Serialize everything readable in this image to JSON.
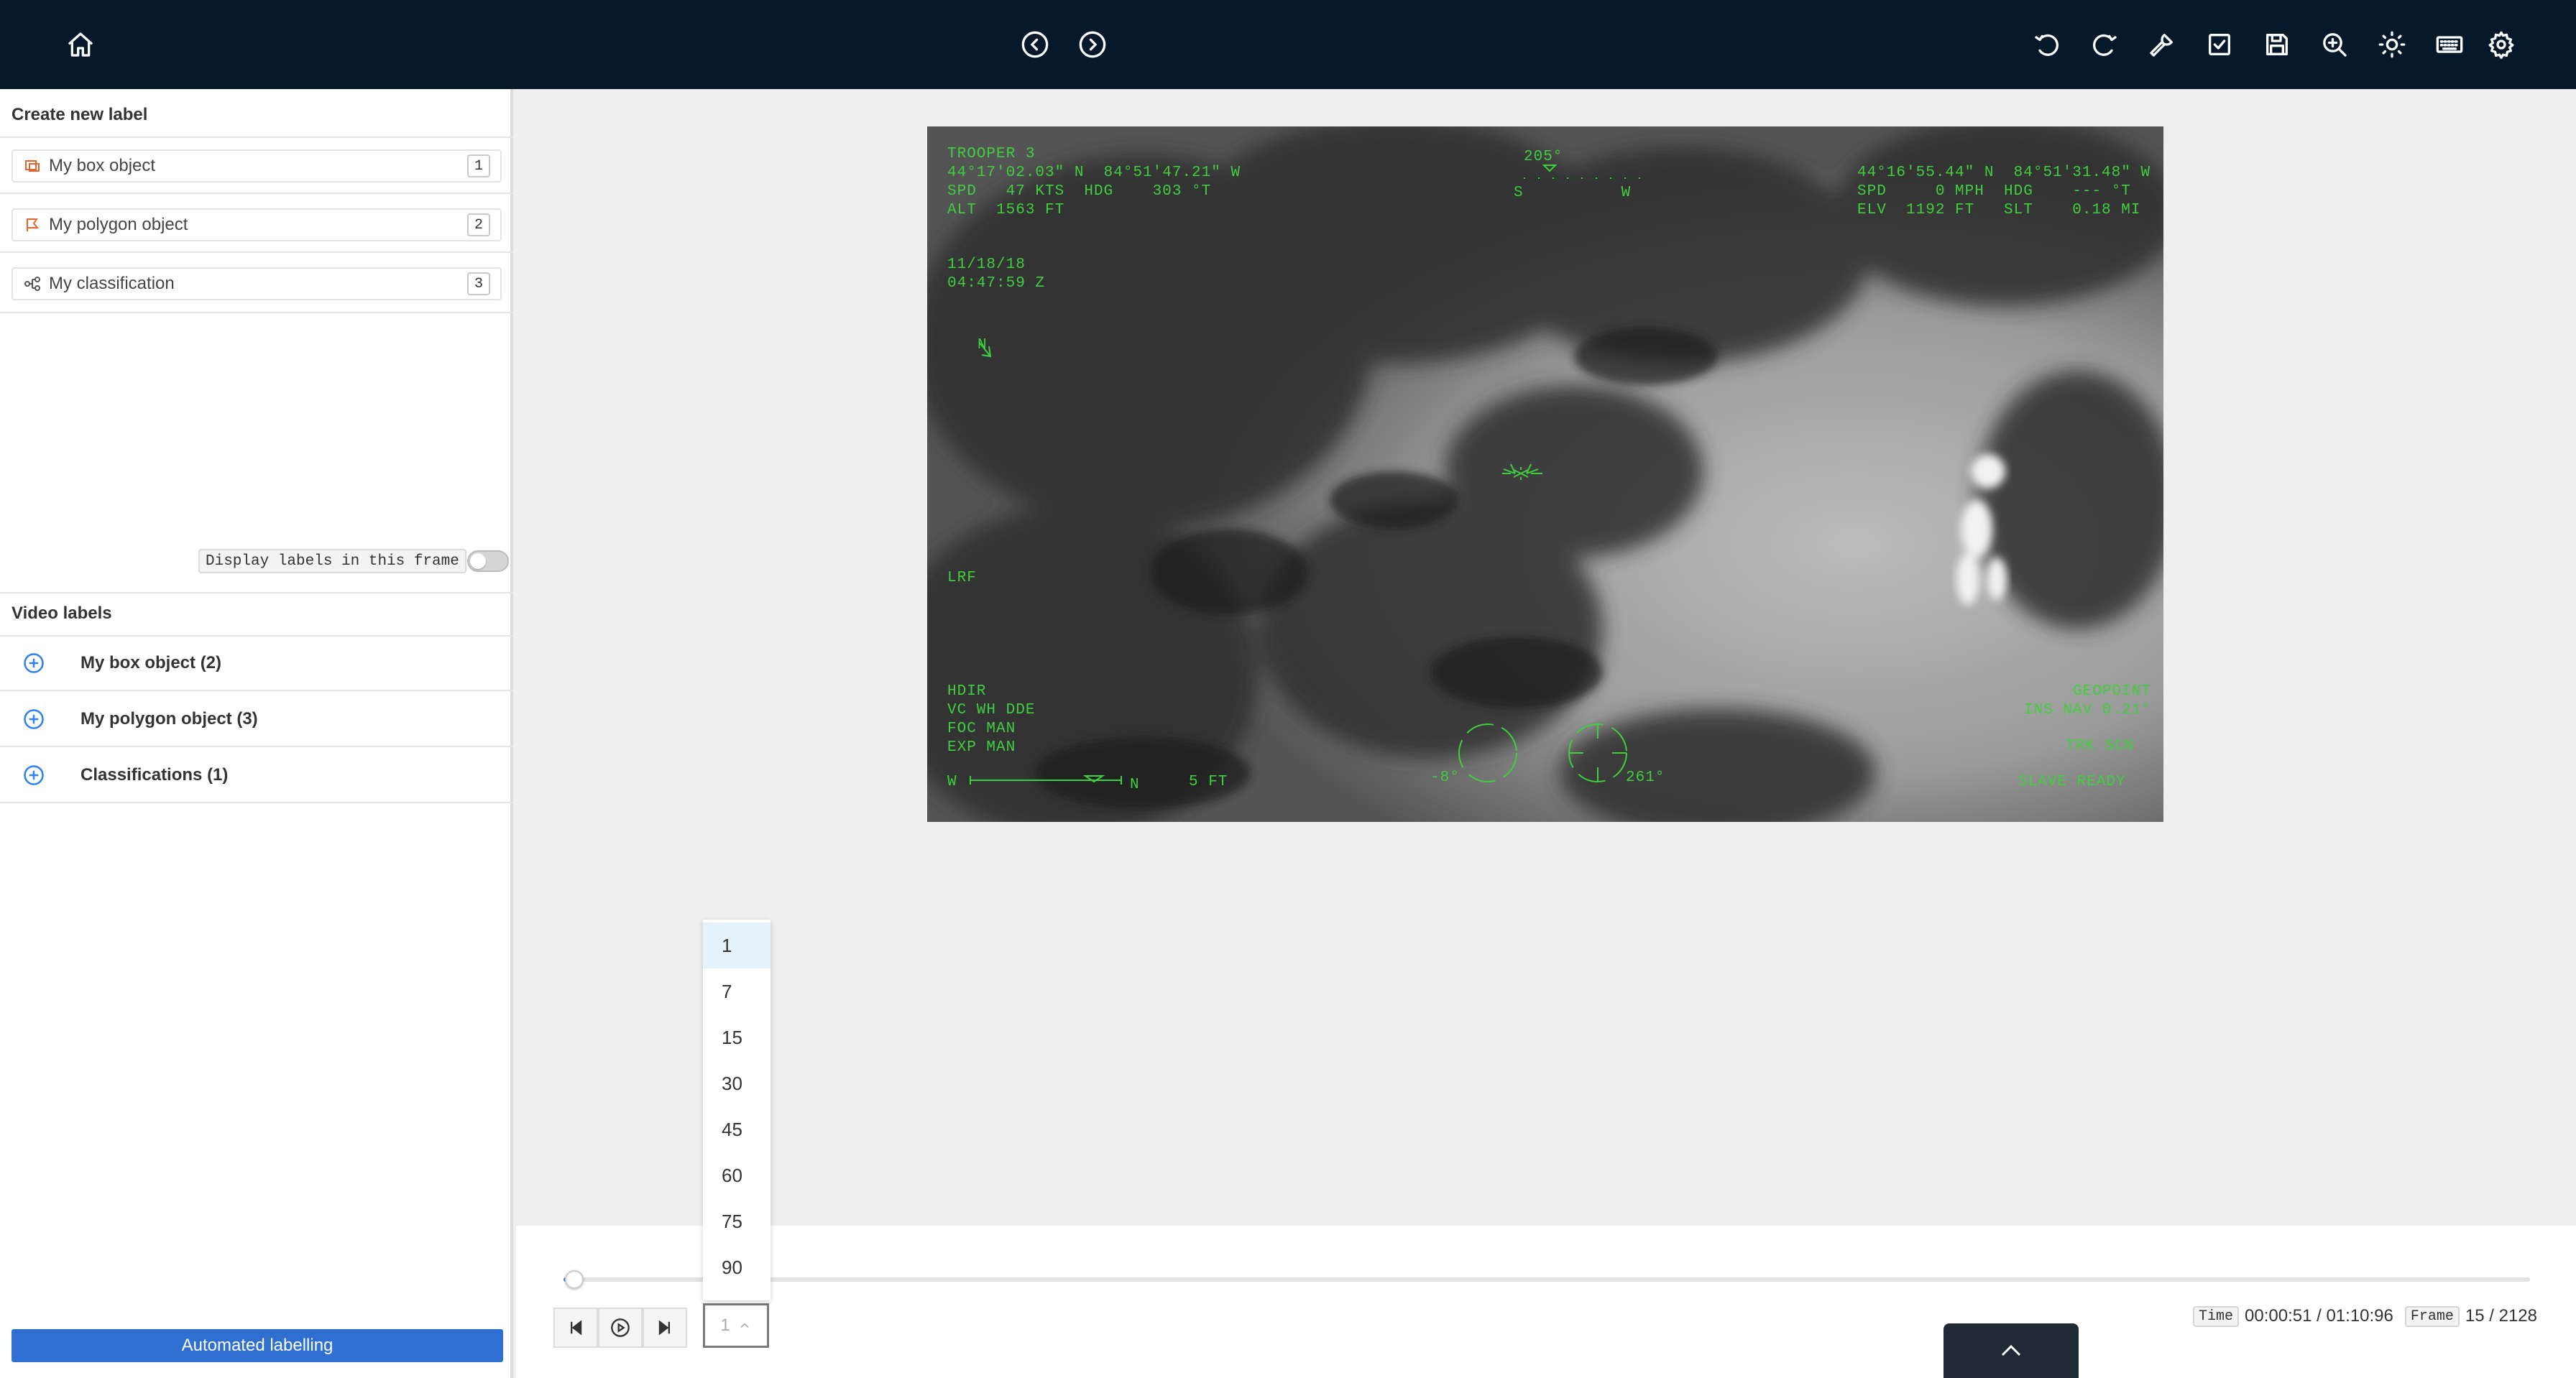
{
  "topbar": {
    "icons": [
      "home-icon",
      "back-icon",
      "forward-icon",
      "undo-icon",
      "redo-icon",
      "wrench-icon",
      "check-icon",
      "save-icon",
      "zoom-icon",
      "brightness-icon",
      "keyboard-icon",
      "gear-icon"
    ]
  },
  "sidebar": {
    "create_heading": "Create new label",
    "new_labels": [
      {
        "name": "My box object",
        "key": "1",
        "icon": "box-icon",
        "color": "#e8632b"
      },
      {
        "name": "My polygon object",
        "key": "2",
        "icon": "polygon-icon",
        "color": "#e8632b"
      },
      {
        "name": "My classification",
        "key": "3",
        "icon": "classification-icon",
        "color": "#555555"
      }
    ],
    "display_labels_text": "Display labels in this frame",
    "display_labels_on": false,
    "video_labels_heading": "Video labels",
    "video_labels": [
      {
        "name": "My box object (2)"
      },
      {
        "name": "My polygon object (3)"
      },
      {
        "name": "Classifications (1)"
      }
    ],
    "automated_button": "Automated labelling"
  },
  "video_overlay": {
    "callsign": "TROOPER 3",
    "heading_marker": "205°",
    "top_left": "44°17'02.03\" N  84°51'47.21\" W\nSPD   47 KTS  HDG    303 °T\nALT  1563 FT",
    "compass_scale": "S          W",
    "top_right": "44°16'55.44\" N  84°51'31.48\" W\nSPD     0 MPH  HDG    --- °T\nELV  1192 FT   SLT    0.18 MI",
    "date_time": "11/18/18\n04:47:59 Z",
    "north": "N",
    "lrf": "LRF",
    "bottom_left": "HDIR\nVC WH DDE\nFOC MAN\nEXP MAN",
    "scale_w": "W",
    "scale_n": "N",
    "scale_ft": "5 FT",
    "bottom_right": "GEOPOINT\nINS NAV 0.21°",
    "trk": "TRK SCN",
    "slave": "SLAVE READY",
    "tilt": "-8°",
    "pan": "261°"
  },
  "playback": {
    "speed_options": [
      "1",
      "7",
      "15",
      "30",
      "45",
      "60",
      "75",
      "90"
    ],
    "speed_selected": "1",
    "time_tag": "Time",
    "time_value": "00:00:51 / 01:10:96",
    "frame_tag": "Frame",
    "frame_value": "15 / 2128",
    "progress_fraction": 0.007
  }
}
